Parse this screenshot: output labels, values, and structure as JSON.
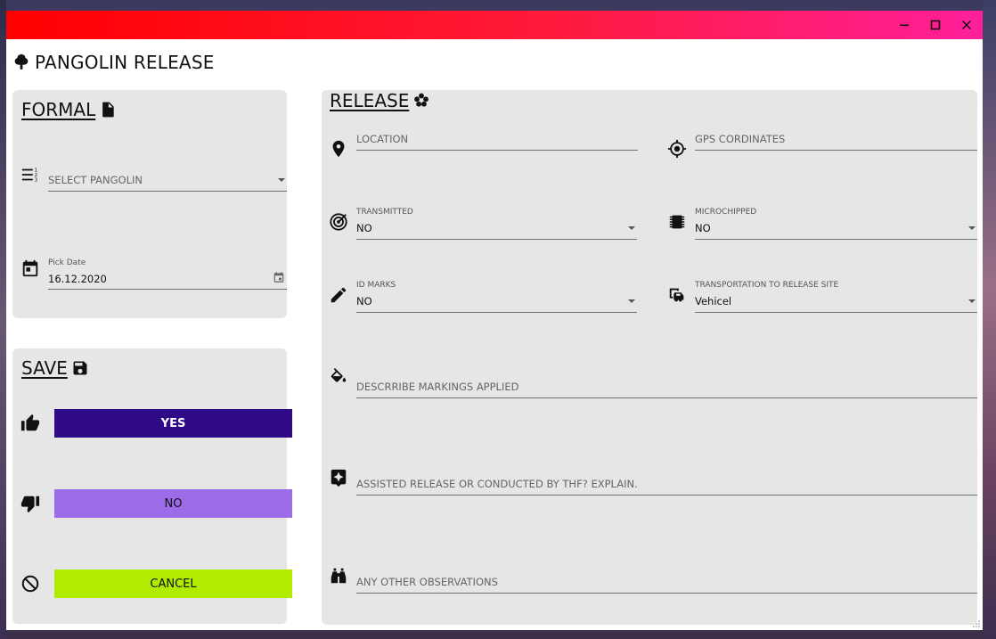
{
  "window": {
    "title_gradient": [
      "#ff0000",
      "#ff1f9a"
    ],
    "controls": {
      "minimize_icon": "minimize-icon",
      "maximize_icon": "maximize-icon",
      "close_icon": "close-icon"
    }
  },
  "app": {
    "title": "PANGOLIN RELEASE",
    "logo_icon": "tree-icon"
  },
  "formal": {
    "heading": "FORMAL",
    "heading_icon": "document-icon",
    "select_pangolin": {
      "placeholder": "SELECT PANGOLIN",
      "icon": "numbered-list-icon"
    },
    "pick_date": {
      "label": "Pick Date",
      "value": "16.12.2020",
      "icon": "calendar-icon"
    }
  },
  "save": {
    "heading": "SAVE",
    "heading_icon": "floppy-disk-icon",
    "yes": {
      "label": "YES",
      "icon": "thumbs-up-icon",
      "color": "#2e0a86"
    },
    "no": {
      "label": "NO",
      "icon": "thumbs-down-icon",
      "color": "#9b6be8"
    },
    "cancel": {
      "label": "CANCEL",
      "icon": "prohibited-icon",
      "color": "#b1ec00"
    }
  },
  "release": {
    "heading": "RELEASE",
    "heading_icon": "flower-icon",
    "location": {
      "placeholder": "LOCATION",
      "icon": "map-pin-icon"
    },
    "gps": {
      "placeholder": "GPS CORDINATES",
      "icon": "crosshair-icon"
    },
    "transmitted": {
      "label": "TRANSMITTED",
      "value": "NO",
      "icon": "radar-icon"
    },
    "microchipped": {
      "label": "MICROCHIPPED",
      "value": "NO",
      "icon": "chip-icon"
    },
    "id_marks": {
      "label": "ID MARKS",
      "value": "NO",
      "icon": "marker-icon"
    },
    "transportation": {
      "label": "TRANSPORTATION TO RELEASE SITE",
      "value": "Vehicel",
      "icon": "vehicles-icon"
    },
    "markings": {
      "placeholder": "DESCRRIBE MARKINGS APPLIED",
      "icon": "paint-bucket-icon"
    },
    "assisted": {
      "placeholder": "ASSISTED RELEASE OR CONDUCTED BY THF? EXPLAIN.",
      "icon": "sparkle-note-icon"
    },
    "observations": {
      "placeholder": "ANY OTHER OBSERVATIONS",
      "icon": "binoculars-icon"
    }
  }
}
